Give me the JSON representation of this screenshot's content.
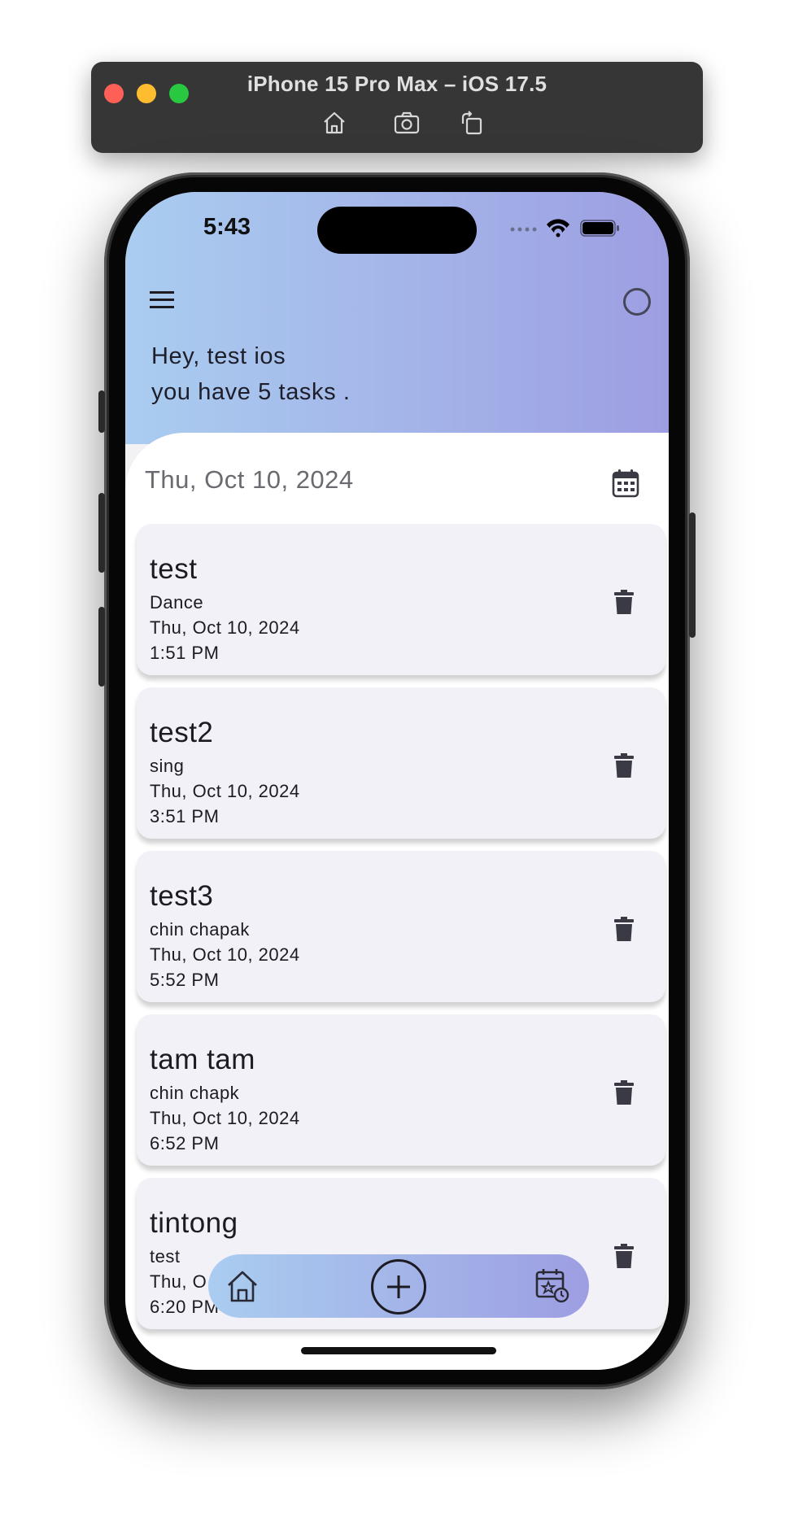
{
  "window": {
    "title": "iPhone 15 Pro Max – iOS 17.5",
    "tools": [
      "home-icon",
      "screenshot-icon",
      "rotate-icon"
    ]
  },
  "status_bar": {
    "time": "5:43"
  },
  "header": {
    "greeting_line1": "Hey, test ios",
    "greeting_line2": "you have 5 tasks ."
  },
  "date_bar": {
    "date": "Thu, Oct 10, 2024"
  },
  "tasks": [
    {
      "title": "test",
      "category": "Dance",
      "date": "Thu, Oct 10, 2024",
      "time": "1:51 PM"
    },
    {
      "title": "test2",
      "category": "sing",
      "date": "Thu, Oct 10, 2024",
      "time": "3:51 PM"
    },
    {
      "title": "test3",
      "category": "chin chapak",
      "date": "Thu, Oct 10, 2024",
      "time": "5:52 PM"
    },
    {
      "title": "tam tam",
      "category": "chin chapk",
      "date": "Thu, Oct 10, 2024",
      "time": "6:52 PM"
    },
    {
      "title": "tintong",
      "category": "test",
      "date": "Thu, O",
      "time": "6:20 PM"
    }
  ],
  "colors": {
    "gradient_start": "#aacdf0",
    "gradient_end": "#9d9ee2",
    "card_bg": "#f3f1f8"
  }
}
